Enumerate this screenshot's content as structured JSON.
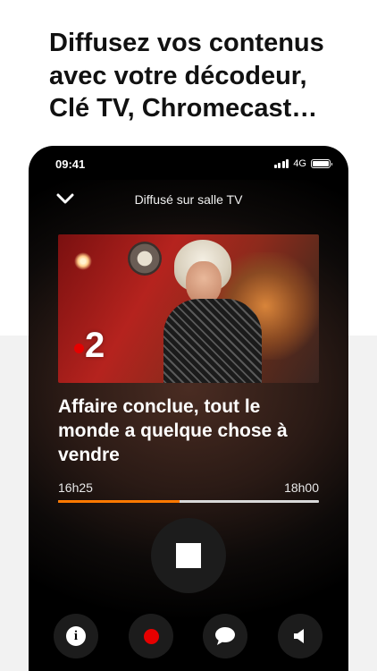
{
  "headline": {
    "line1": "Diffusez vos contenus",
    "line2": "avec votre décodeur,",
    "line3": "Clé TV, Chromecast…"
  },
  "status_bar": {
    "time": "09:41",
    "network": "4G",
    "icons": [
      "signal-icon",
      "battery-icon"
    ]
  },
  "player": {
    "header_title": "Diffusé sur salle TV",
    "collapse_icon": "chevron-down-icon",
    "channel_number": "2",
    "channel_dot_color": "#e60000",
    "program_title": "Affaire conclue, tout le monde a quelque chose à vendre",
    "start_time": "16h25",
    "end_time": "18h00",
    "progress_fraction": 0.465,
    "progress_color": "#ff7900",
    "stop_icon": "stop-icon",
    "actions": [
      {
        "name": "info-button",
        "icon": "info-icon"
      },
      {
        "name": "record-button",
        "icon": "record-icon",
        "color": "#e60000"
      },
      {
        "name": "comment-button",
        "icon": "speech-bubble-icon"
      },
      {
        "name": "volume-button",
        "icon": "speaker-icon"
      }
    ]
  }
}
